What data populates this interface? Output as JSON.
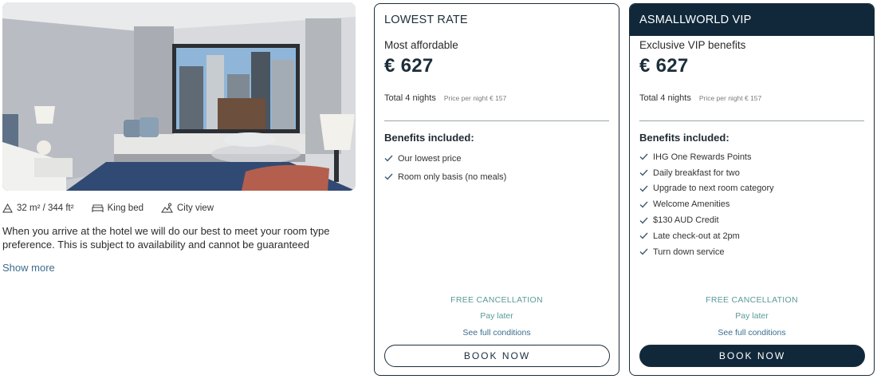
{
  "room": {
    "photo_alt": "hotel-room-photo",
    "features": [
      {
        "icon": "area-icon",
        "label": "32 m² / 344 ft²"
      },
      {
        "icon": "bed-icon",
        "label": "King bed"
      },
      {
        "icon": "city-view-icon",
        "label": "City view"
      }
    ],
    "description": "When you arrive at the hotel we will do our best to meet your room type preference. This is subject to availability and cannot be guaranteed",
    "show_more": "Show more"
  },
  "rates": [
    {
      "header": "LOWEST RATE",
      "tagline": "Most affordable",
      "price": "€ 627",
      "total": "Total 4 nights",
      "per_night": "Price per night € 157",
      "benefits_title": "Benefits included:",
      "benefits": [
        "Our lowest price",
        "Room only basis (no meals)"
      ],
      "cancellation": "FREE CANCELLATION",
      "payment": "Pay later",
      "conditions": "See full conditions",
      "book": "BOOK NOW"
    },
    {
      "header": "ASMALLWORLD VIP",
      "tagline": "Exclusive VIP benefits",
      "price": "€ 627",
      "total": "Total 4 nights",
      "per_night": "Price per night € 157",
      "benefits_title": "Benefits included:",
      "benefits": [
        "IHG One Rewards Points",
        "Daily breakfast for two",
        "Upgrade to next room category",
        "Welcome Amenities",
        "$130 AUD Credit",
        "Late check-out at 2pm",
        "Turn down service"
      ],
      "cancellation": "FREE CANCELLATION",
      "payment": "Pay later",
      "conditions": "See full conditions",
      "book": "BOOK NOW"
    }
  ],
  "colors": {
    "navy": "#10283a",
    "teal": "#5a9a98",
    "link": "#3c6d8e"
  }
}
